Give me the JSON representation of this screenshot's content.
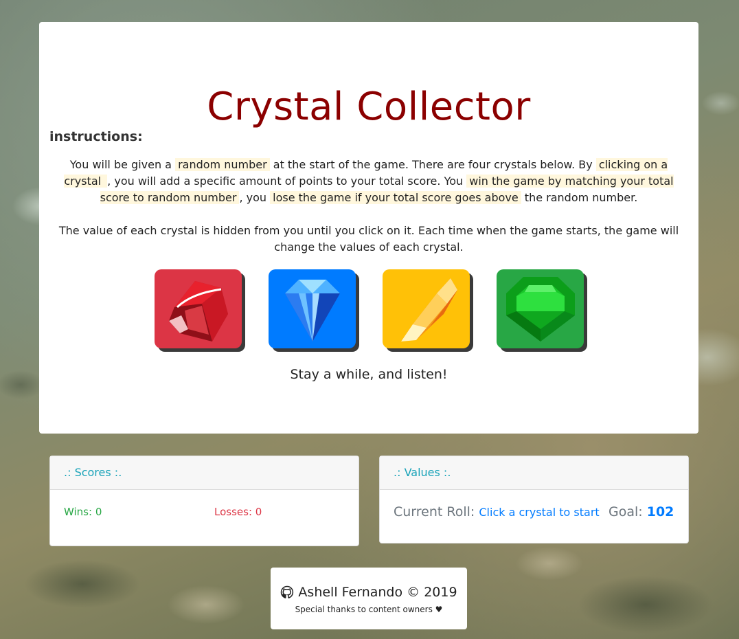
{
  "title": "Crystal Collector",
  "instructions": {
    "heading": "instructions:",
    "p1": [
      "You will be given a ",
      "random number",
      " at the start of the game. There are four crystals below. By ",
      "clicking on a crystal ",
      ", you will add a specific amount of points to your total score. You ",
      "win the game by matching your total score to random number",
      ", you ",
      "lose the game if your total score goes above",
      " the random number."
    ],
    "p2": "The value of each crystal is hidden from you until you click on it. Each time when the game starts, the game will change the values of each crystal."
  },
  "crystals": [
    {
      "name": "ruby",
      "color": "#dc3545"
    },
    {
      "name": "sapphire",
      "color": "#007bff"
    },
    {
      "name": "topaz",
      "color": "#ffc107"
    },
    {
      "name": "emerald",
      "color": "#28a745"
    }
  ],
  "message": "Stay a while, and listen!",
  "scores": {
    "heading": ".: Scores :.",
    "wins_label": "Wins: ",
    "wins": "0",
    "losses_label": "Losses: ",
    "losses": "0"
  },
  "values": {
    "heading": ".: Values :.",
    "roll_label": "Current Roll: ",
    "roll_value": "Click a crystal to start",
    "goal_label": "Goal: ",
    "goal_value": "102"
  },
  "footer": {
    "icon": "github-icon",
    "author": "Ashell Fernando © 2019",
    "thanks": "Special thanks to content owners ♥"
  },
  "colors": {
    "title": "#8b0000",
    "highlight": "#fff7dd",
    "panel_heading": "#17a2b8",
    "wins": "#28a745",
    "losses": "#dc3545",
    "value_accent": "#007bff"
  }
}
